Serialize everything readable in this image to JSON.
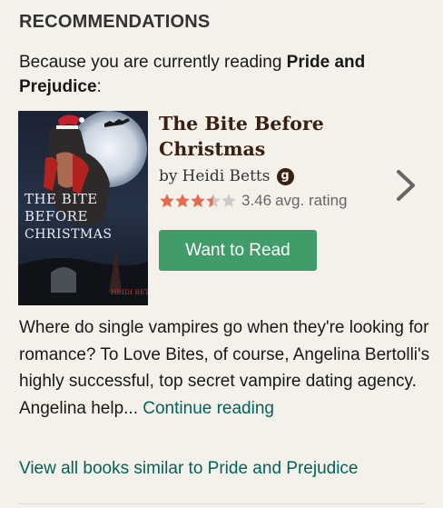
{
  "section": {
    "title": "RECOMMENDATIONS"
  },
  "reason": {
    "prefix": "Because you are currently reading ",
    "book": "Pride and Prejudice",
    "suffix": ":"
  },
  "book": {
    "title": "The Bite Before Christmas",
    "by": "by",
    "author": "Heidi Betts",
    "goodreads_author_badge": "g",
    "rating_value": 3.46,
    "rating": "3.46",
    "rating_suffix": "avg. rating",
    "want_button": "Want to Read",
    "cover": {
      "title_lines": [
        "THE BITE",
        "BEFORE",
        "CHRISTMAS"
      ],
      "author": "HEIDI BETTS"
    }
  },
  "description": {
    "text": "Where do single vampires go when they're looking for romance? To Love Bites, of course, Angelina Bertolli's highly successful, top secret vampire dating agency. Angelina help... ",
    "continue_link": "Continue reading"
  },
  "view_all": "View all books similar to Pride and Prejudice",
  "icons": {
    "next": "chevron-right-icon",
    "star": "star-icon",
    "author_badge": "goodreads-author-icon"
  },
  "colors": {
    "background": "#f4f1ea",
    "button": "#409d69",
    "link": "#00635d",
    "star_filled": "#e76a4f",
    "star_empty": "#cccccc",
    "title": "#382110"
  }
}
